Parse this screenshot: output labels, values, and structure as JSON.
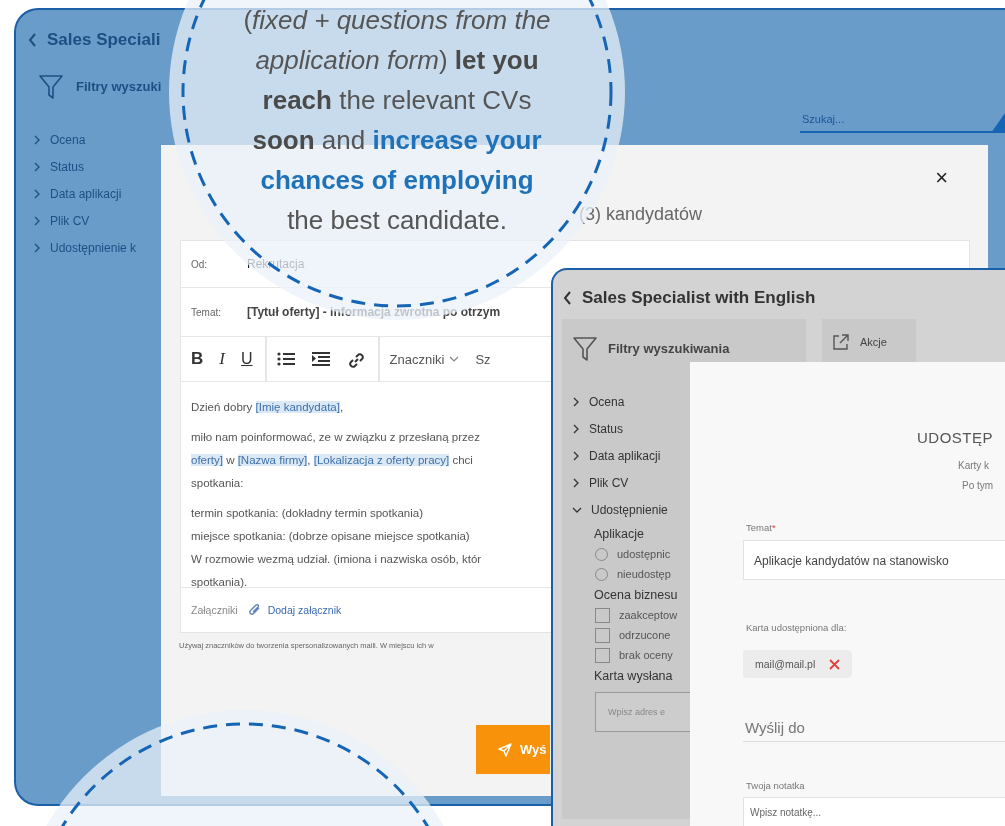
{
  "back_window": {
    "title": "Sales Speciali",
    "filter_title": "Filtry wyszuki",
    "filters": [
      {
        "label": "Ocena",
        "expanded": false
      },
      {
        "label": "Status",
        "expanded": false
      },
      {
        "label": "Data aplikacji",
        "expanded": false
      },
      {
        "label": "Plik CV",
        "expanded": false
      },
      {
        "label": "Udostępnienie k",
        "expanded": false
      }
    ],
    "search": {
      "placeholder": "Szukaj..."
    }
  },
  "message_dialog": {
    "title": "(3) kandydatów",
    "close": "×",
    "from": {
      "label": "Od:",
      "value": "Rekrutacja"
    },
    "subject": {
      "label": "Temat:",
      "value": "[Tytuł oferty] - informacja zwrotna po otrzym"
    },
    "toolbar": [
      [
        {
          "kind": "bold",
          "label": "B"
        },
        {
          "kind": "italic",
          "label": "I"
        },
        {
          "kind": "underline",
          "label": "U"
        }
      ],
      [
        {
          "kind": "list"
        },
        {
          "kind": "indent"
        },
        {
          "kind": "link"
        }
      ],
      [
        {
          "kind": "dropdown",
          "label": "Znaczniki"
        },
        {
          "kind": "text",
          "label": "Sz"
        }
      ]
    ],
    "body": [
      [
        [
          {
            "text": "Dzień dobry ",
            "kind": "text"
          },
          {
            "text": "[Imię kandydata]",
            "kind": "tag"
          },
          {
            "text": ",",
            "kind": "text"
          }
        ]
      ],
      [
        [
          {
            "text": "miło nam poinformować, ze w związku z przesłaną przez",
            "kind": "text"
          }
        ],
        [
          {
            "text": "oferty]",
            "kind": "tag"
          },
          {
            "text": " w ",
            "kind": "text"
          },
          {
            "text": "[Nazwa firmy]",
            "kind": "tag"
          },
          {
            "text": ", ",
            "kind": "text"
          },
          {
            "text": "[Lokalizacja z oferty pracy]",
            "kind": "tag"
          },
          {
            "text": " chci",
            "kind": "text"
          }
        ],
        [
          {
            "text": "spotkania:",
            "kind": "text"
          }
        ]
      ],
      [
        [
          {
            "text": "termin spotkania: (dokładny termin spotkania)",
            "kind": "text"
          }
        ],
        [
          {
            "text": "miejsce spotkania: (dobrze opisane miejsce spotkania)",
            "kind": "text"
          }
        ],
        [
          {
            "text": "W rozmowie wezmą udział. (imiona i nazwiska osób, któr",
            "kind": "text"
          }
        ],
        [
          {
            "text": "spotkania).",
            "kind": "text"
          }
        ]
      ]
    ],
    "attachments": {
      "label": "Załączniki",
      "link": "Dodaj załącznik"
    },
    "hint": "Używaj znaczników do tworzenia spersonalizowanych maili. W miejscu ich w",
    "send_button": "Wyś"
  },
  "front_window": {
    "title": "Sales Specialist with English",
    "filter_title": "Filtry wyszukiwania",
    "actions_button": "Akcje",
    "filters": [
      {
        "label": "Ocena",
        "expanded": false
      },
      {
        "label": "Status",
        "expanded": false
      },
      {
        "label": "Data aplikacji",
        "expanded": false
      },
      {
        "label": "Plik CV",
        "expanded": false
      },
      {
        "label": "Udostępnienie",
        "expanded": true
      }
    ],
    "groups": [
      {
        "title": "Aplikacje",
        "options": [
          {
            "kind": "radio",
            "label": "udostępnic",
            "checked": false
          },
          {
            "kind": "radio",
            "label": "nieudostęp",
            "checked": false
          }
        ]
      },
      {
        "title": "Ocena biznesu",
        "options": [
          {
            "kind": "checkbox",
            "label": "zaakceptow",
            "checked": false
          },
          {
            "kind": "checkbox",
            "label": "odrzucone",
            "checked": false
          },
          {
            "kind": "checkbox",
            "label": "brak oceny",
            "checked": false
          }
        ]
      },
      {
        "title": "Karta wysłana",
        "placeholder": "Wpisz adres e"
      }
    ]
  },
  "share_dialog": {
    "heading": "UDOSTĘP",
    "lines": [
      "Karty k",
      "Po tym"
    ],
    "subject": {
      "label": "Temat",
      "required_mark": "*",
      "value": "Aplikacje kandydatów na stanowisko"
    },
    "shared_with": {
      "label": "Karta udostępniona dla:",
      "chips": [
        {
          "text": "mail@mail.pl"
        }
      ]
    },
    "send_to": {
      "placeholder": "Wyślij do"
    },
    "note": {
      "label": "Twoja notatka",
      "placeholder": "Wpisz notatkę..."
    }
  },
  "callout": {
    "lines": [
      [
        {
          "text": "(",
          "kind": "plain"
        },
        {
          "text": "fixed + questions from the",
          "kind": "italic"
        }
      ],
      [
        {
          "text": "application form",
          "kind": "italic"
        },
        {
          "text": ") ",
          "kind": "plain"
        },
        {
          "text": "let you",
          "kind": "bold"
        }
      ],
      [
        {
          "text": "reach",
          "kind": "bold"
        },
        {
          "text": " the relevant CVs",
          "kind": "plain"
        }
      ],
      [
        {
          "text": "soon",
          "kind": "bold"
        },
        {
          "text": " and ",
          "kind": "plain"
        },
        {
          "text": "increase your",
          "kind": "accent"
        }
      ],
      [
        {
          "text": "chances of employing",
          "kind": "accent"
        }
      ],
      [
        {
          "text": "the best candidate.",
          "kind": "plain"
        }
      ]
    ]
  }
}
